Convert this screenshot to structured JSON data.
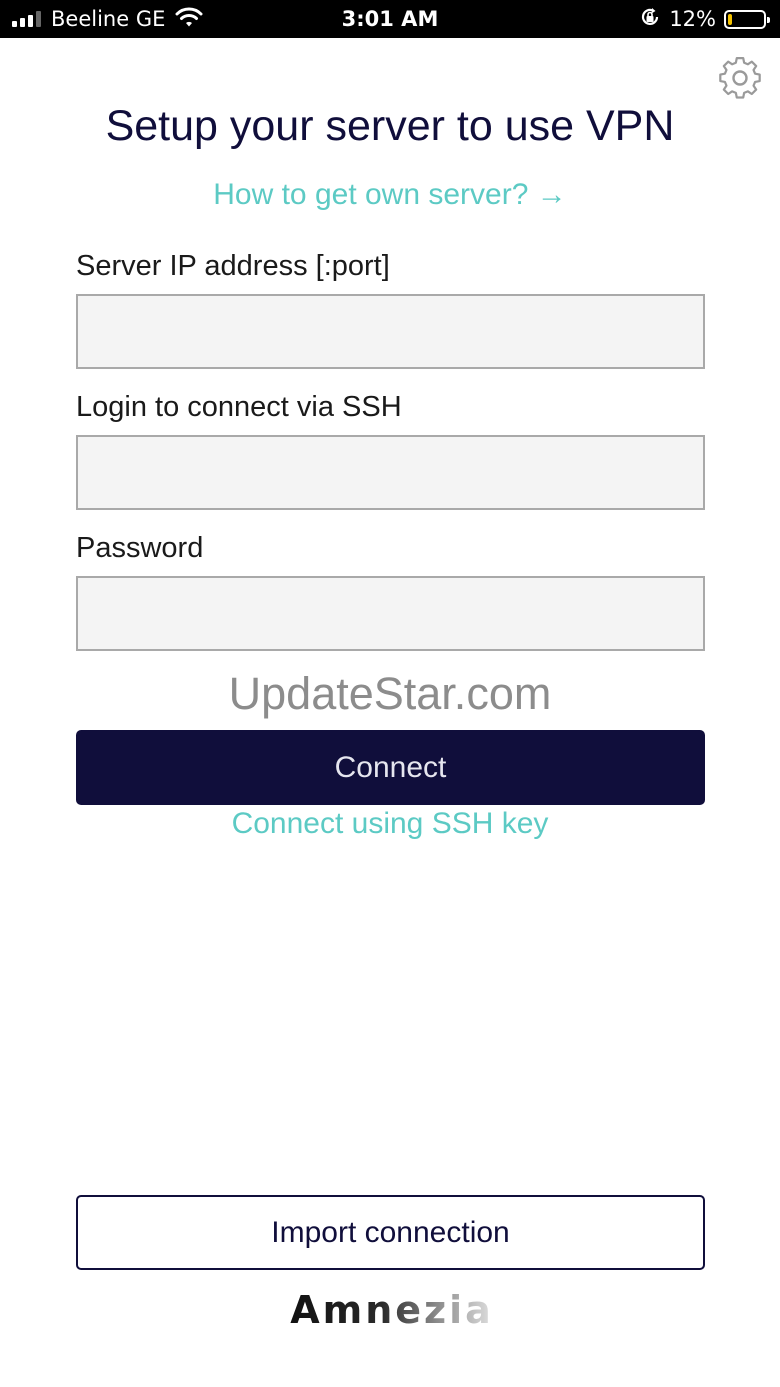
{
  "status_bar": {
    "carrier": "Beeline GE",
    "time": "3:01 AM",
    "battery_percent": "12%",
    "battery_level": 0.12,
    "signal_bars": 3,
    "icons": [
      "signal-icon",
      "wifi-icon",
      "orientation-lock-icon",
      "battery-icon"
    ]
  },
  "settings": {
    "icon": "gear-icon"
  },
  "title": "Setup your server to use VPN",
  "help_link": "How to get own server? →",
  "form": {
    "server": {
      "label": "Server IP address [:port]",
      "value": ""
    },
    "login": {
      "label": "Login to connect via SSH",
      "value": ""
    },
    "password": {
      "label": "Password",
      "value": ""
    }
  },
  "watermark": "UpdateStar.com",
  "connect_button": "Connect",
  "ssh_key_link": "Connect using SSH key",
  "import_button": "Import connection",
  "logo_text": "Amnezia",
  "colors": {
    "primary": "#100e3b",
    "accent": "#5ccac4",
    "field_bg": "#f4f4f4",
    "battery_low": "#f5c400"
  }
}
